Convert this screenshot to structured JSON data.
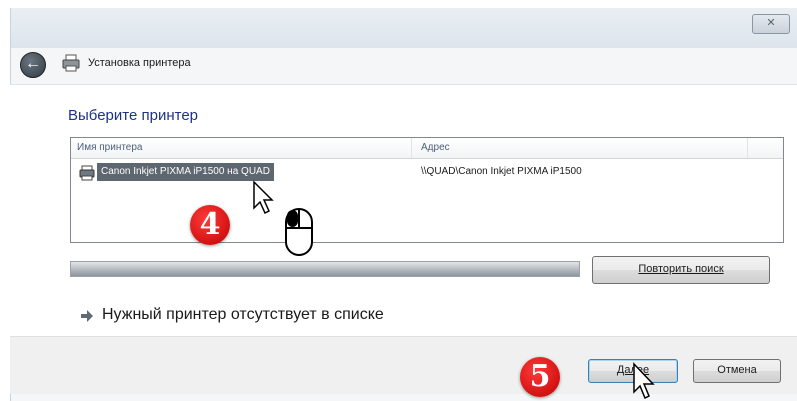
{
  "window": {
    "title": "Установка принтера",
    "close_label": "✕"
  },
  "heading": "Выберите принтер",
  "list": {
    "columns": [
      "Имя принтера",
      "Адрес"
    ],
    "rows": [
      {
        "name": "Canon Inkjet PIXMA iP1500 на QUAD",
        "address": "\\\\QUAD\\Canon Inkjet PIXMA iP1500"
      }
    ]
  },
  "buttons": {
    "retry": "Повторить поиск",
    "next": "Далее",
    "cancel": "Отмена"
  },
  "missing_link": "Нужный принтер отсутствует в списке",
  "badges": [
    "4",
    "5"
  ],
  "icons": [
    "back-arrow-icon",
    "printer-icon",
    "mouse-icon",
    "cursor-arrow-icon",
    "link-arrow-icon",
    "close-icon"
  ],
  "colors": {
    "heading": "#1e3287",
    "badge": "#d40000",
    "selection": "#5d6770"
  }
}
